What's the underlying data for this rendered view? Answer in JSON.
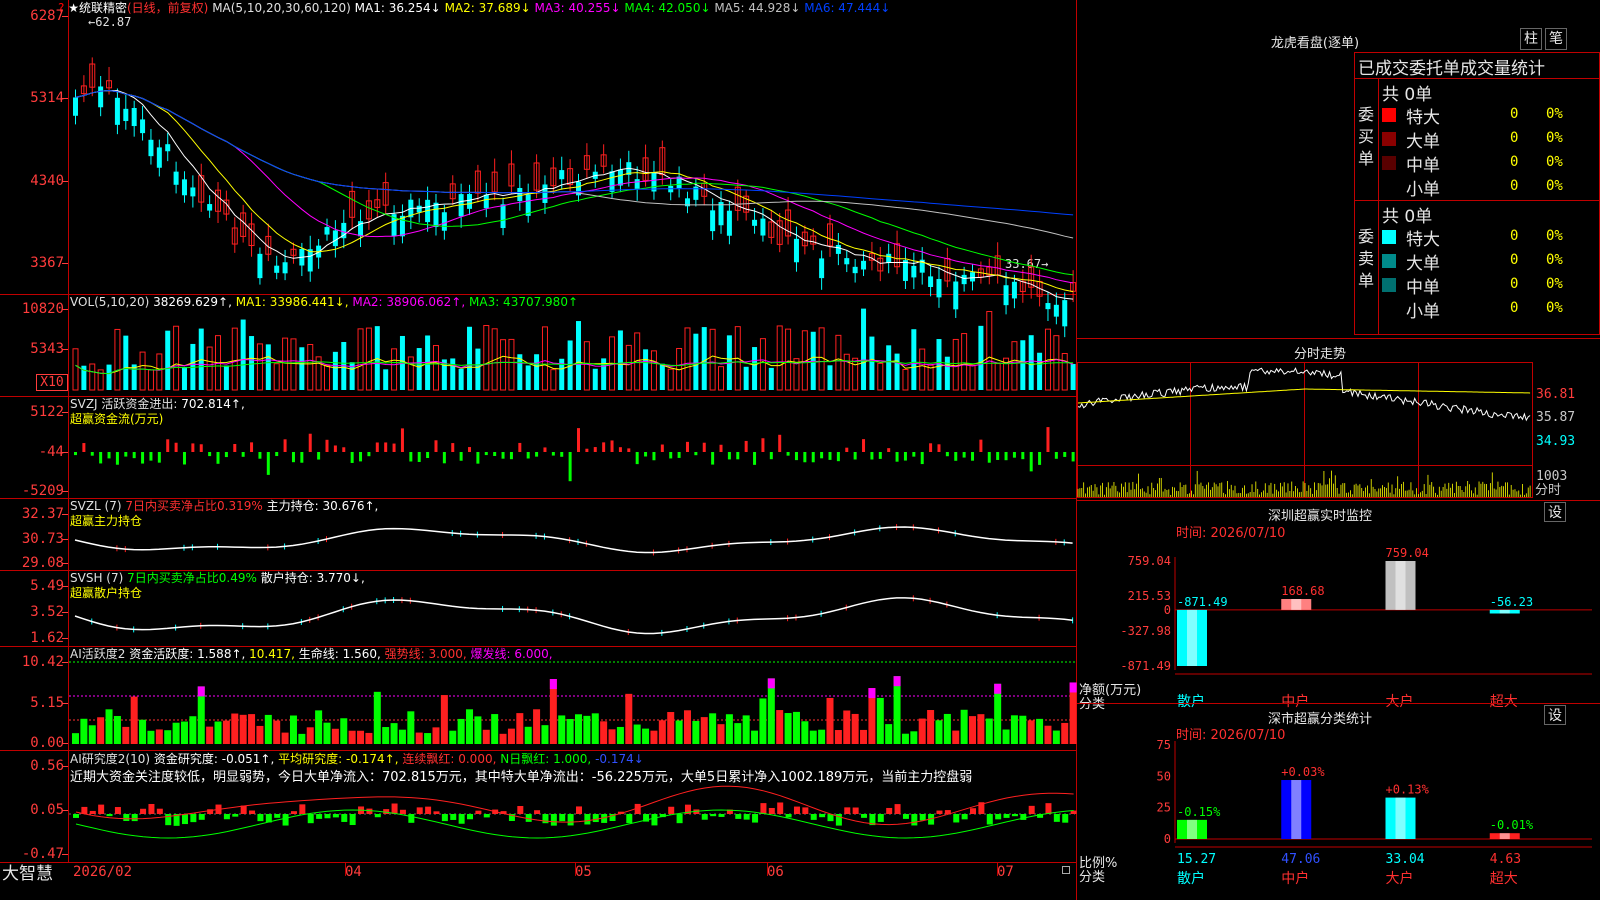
{
  "main": {
    "stock": "统联精密",
    "mode": "(日线，前复权)",
    "ma_header": "MA(5,10,20,30,60,120)",
    "ma": [
      {
        "label": "MA1:",
        "value": "36.254↓",
        "color": "#ffffff"
      },
      {
        "label": "MA2:",
        "value": "37.689↓",
        "color": "#ffff00"
      },
      {
        "label": "MA3:",
        "value": "40.255↓",
        "color": "#ff00ff"
      },
      {
        "label": "MA4:",
        "value": "42.050↓",
        "color": "#00ff00"
      },
      {
        "label": "MA5:",
        "value": "44.928↓",
        "color": "#c0c0c0"
      },
      {
        "label": "MA6:",
        "value": "47.444↓",
        "color": "#0040ff"
      }
    ],
    "yaxis": [
      "6287",
      "5314",
      "4340",
      "3367"
    ],
    "high_label": "62.87",
    "low_label": "33.67→"
  },
  "vol": {
    "title": "VOL(5,10,20)",
    "value": "38269.629↑,",
    "ma": [
      {
        "label": "MA1:",
        "value": "33986.441↓,",
        "color": "#ffff00"
      },
      {
        "label": "MA2:",
        "value": "38906.062↑,",
        "color": "#ff00ff"
      },
      {
        "label": "MA3:",
        "value": "43707.980↑",
        "color": "#00ff00"
      }
    ],
    "yaxis": [
      "10820",
      "5343"
    ],
    "unit": "X10"
  },
  "svzj": {
    "title": "SVZJ  活跃资金进出:",
    "value": "702.814↑,",
    "sub": "超赢资金流(万元)",
    "yaxis": [
      "5122",
      "-44",
      "-5209"
    ]
  },
  "svzl": {
    "title": "SVZL (7)",
    "ratio": "7日内买卖净占比0.319%",
    "label": "主力持仓:",
    "value": "30.676↑,",
    "sub": "超赢主力持仓",
    "yaxis": [
      "32.37",
      "30.73",
      "29.08"
    ]
  },
  "svsh": {
    "title": "SVSH (7)",
    "ratio": "7日内买卖净占比0.49%",
    "label": "散户持仓:",
    "value": "3.770↓,",
    "sub": "超赢散户持仓",
    "yaxis": [
      "5.49",
      "3.52",
      "1.62"
    ]
  },
  "ai1": {
    "title": "AI活跃度2",
    "label": "资金活跃度:",
    "value": "1.588↑,",
    "v2": "10.417,",
    "life_label": "生命线:",
    "life": "1.560,",
    "strong": "强势线: 3.000,",
    "burst": "爆发线: 6.000,",
    "yaxis": [
      "10.42",
      "5.15",
      "0.00"
    ]
  },
  "ai2": {
    "title": "AI研究度2(10)",
    "label": "资金研究度:",
    "value": "-0.051↑,",
    "avg": "平均研究度: -0.174↑,",
    "red": "连续飘红: 0.000,",
    "nred": "N日飘红: 1.000,",
    "last": "-0.174↓",
    "comment": "近期大资金关注度较低，明显弱势，今日大单净流入：702.815万元，其中特大单净流出：-56.225万元，大单5日累计净入1002.189万元，当前主力控盘弱",
    "yaxis": [
      "0.56",
      "0.05",
      "-0.47"
    ]
  },
  "timeline": {
    "brand": "大智慧",
    "labels": [
      "2026/02",
      "04",
      "05",
      "06",
      "07"
    ]
  },
  "dragon": {
    "title": "龙虎看盘(逐单)",
    "btn1": "柱",
    "btn2": "笔",
    "header": "已成交委托单成交量统计",
    "buy_label": "委买单",
    "sell_label": "委卖单",
    "buy_total": "共 0单",
    "sell_total": "共 0单",
    "buy_rows": [
      {
        "name": "特大",
        "qty": "0",
        "pct": "0%",
        "color": "#ff0000"
      },
      {
        "name": "大单",
        "qty": "0",
        "pct": "0%",
        "color": "#8b0000"
      },
      {
        "name": "中单",
        "qty": "0",
        "pct": "0%",
        "color": "#5a0000"
      },
      {
        "name": "小单",
        "qty": "0",
        "pct": "0%",
        "color": ""
      }
    ],
    "sell_rows": [
      {
        "name": "特大",
        "qty": "0",
        "pct": "0%",
        "color": "#00ffff"
      },
      {
        "name": "大单",
        "qty": "0",
        "pct": "0%",
        "color": "#008b8b"
      },
      {
        "name": "中单",
        "qty": "0",
        "pct": "0%",
        "color": "#007070"
      },
      {
        "name": "小单",
        "qty": "0",
        "pct": "0%",
        "color": ""
      }
    ]
  },
  "intraday": {
    "title": "分时走势",
    "yaxis": [
      "36.81",
      "35.87",
      "34.93"
    ],
    "vol_max": "1003",
    "unit": "分时"
  },
  "sz_monitor": {
    "title": "深圳超赢实时监控",
    "btn": "设",
    "time": "时间: 2026/07/10",
    "yaxis": [
      "759.04",
      "215.53",
      "0",
      "-327.98",
      "-871.49"
    ],
    "ylabel": "净额(万元)",
    "xlabel": "分类",
    "categories": [
      "散户",
      "中户",
      "大户",
      "超大"
    ],
    "values": [
      -871.49,
      168.68,
      759.04,
      -56.23
    ],
    "value_labels": [
      "-871.49",
      "168.68",
      "759.04",
      "-56.23"
    ]
  },
  "sz_stats": {
    "title": "深市超赢分类统计",
    "btn": "设",
    "time": "时间: 2026/07/10",
    "yaxis": [
      "75",
      "50",
      "25",
      "0"
    ],
    "ylabel": "比例%",
    "xlabel": "分类",
    "categories": [
      "散户",
      "中户",
      "大户",
      "超大"
    ],
    "values": [
      15.27,
      47.06,
      33.04,
      4.63
    ],
    "value_labels": [
      "15.27",
      "47.06",
      "33.04",
      "4.63"
    ],
    "changes": [
      "-0.15%",
      "+0.03%",
      "+0.13%",
      "-0.01%"
    ]
  },
  "colors": {
    "up": "#ff2020",
    "down": "#00ffff",
    "grid": "#c00000",
    "axis": "#ff3c3c"
  }
}
